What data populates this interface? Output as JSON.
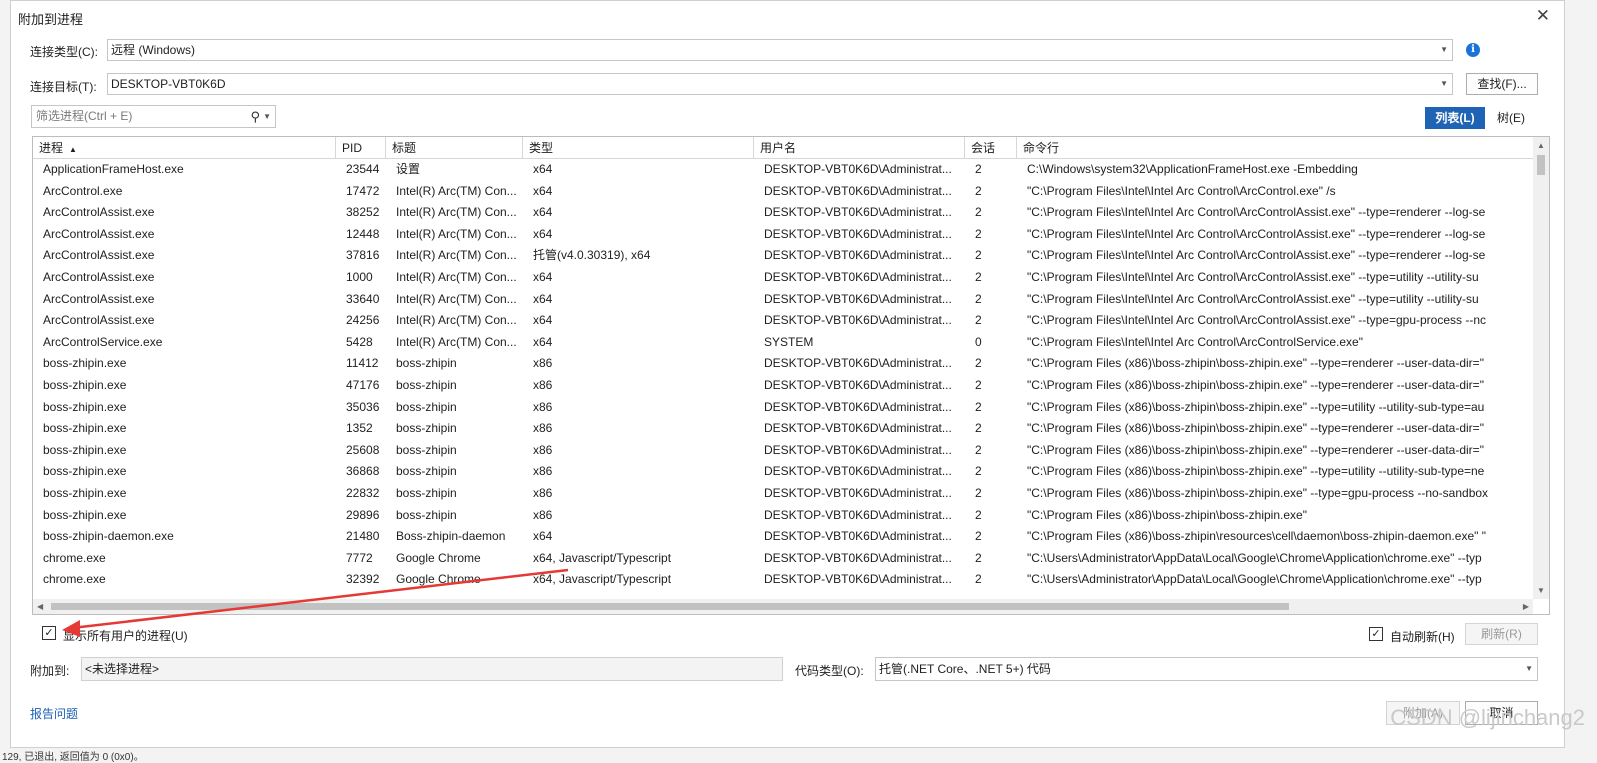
{
  "dialog": {
    "title": "附加到进程",
    "close_glyph": "✕"
  },
  "connection": {
    "type_label": "连接类型(C):",
    "type_value": "远程 (Windows)",
    "target_label": "连接目标(T):",
    "target_value": "DESKTOP-VBT0K6D",
    "find_button": "查找(F)..."
  },
  "filter": {
    "placeholder": "筛选进程(Ctrl + E)"
  },
  "view_toggle": {
    "list": "列表(L)",
    "tree": "树(E)"
  },
  "table": {
    "columns": [
      "进程",
      "PID",
      "标题",
      "类型",
      "用户名",
      "会话",
      "命令行"
    ],
    "rows": [
      [
        "ApplicationFrameHost.exe",
        "23544",
        "设置",
        "x64",
        "DESKTOP-VBT0K6D\\Administrat...",
        "2",
        "C:\\Windows\\system32\\ApplicationFrameHost.exe -Embedding"
      ],
      [
        "ArcControl.exe",
        "17472",
        "Intel(R) Arc(TM) Con...",
        "x64",
        "DESKTOP-VBT0K6D\\Administrat...",
        "2",
        "\"C:\\Program Files\\Intel\\Intel Arc Control\\ArcControl.exe\" /s"
      ],
      [
        "ArcControlAssist.exe",
        "38252",
        "Intel(R) Arc(TM) Con...",
        "x64",
        "DESKTOP-VBT0K6D\\Administrat...",
        "2",
        "\"C:\\Program Files\\Intel\\Intel Arc Control\\ArcControlAssist.exe\" --type=renderer --log-se"
      ],
      [
        "ArcControlAssist.exe",
        "12448",
        "Intel(R) Arc(TM) Con...",
        "x64",
        "DESKTOP-VBT0K6D\\Administrat...",
        "2",
        "\"C:\\Program Files\\Intel\\Intel Arc Control\\ArcControlAssist.exe\" --type=renderer --log-se"
      ],
      [
        "ArcControlAssist.exe",
        "37816",
        "Intel(R) Arc(TM) Con...",
        "托管(v4.0.30319), x64",
        "DESKTOP-VBT0K6D\\Administrat...",
        "2",
        "\"C:\\Program Files\\Intel\\Intel Arc Control\\ArcControlAssist.exe\" --type=renderer --log-se"
      ],
      [
        "ArcControlAssist.exe",
        "1000",
        "Intel(R) Arc(TM) Con...",
        "x64",
        "DESKTOP-VBT0K6D\\Administrat...",
        "2",
        "\"C:\\Program Files\\Intel\\Intel Arc Control\\ArcControlAssist.exe\" --type=utility --utility-su"
      ],
      [
        "ArcControlAssist.exe",
        "33640",
        "Intel(R) Arc(TM) Con...",
        "x64",
        "DESKTOP-VBT0K6D\\Administrat...",
        "2",
        "\"C:\\Program Files\\Intel\\Intel Arc Control\\ArcControlAssist.exe\" --type=utility --utility-su"
      ],
      [
        "ArcControlAssist.exe",
        "24256",
        "Intel(R) Arc(TM) Con...",
        "x64",
        "DESKTOP-VBT0K6D\\Administrat...",
        "2",
        "\"C:\\Program Files\\Intel\\Intel Arc Control\\ArcControlAssist.exe\" --type=gpu-process --nc"
      ],
      [
        "ArcControlService.exe",
        "5428",
        "Intel(R) Arc(TM) Con...",
        "x64",
        "SYSTEM",
        "0",
        "\"C:\\Program Files\\Intel\\Intel Arc Control\\ArcControlService.exe\""
      ],
      [
        "boss-zhipin.exe",
        "11412",
        "boss-zhipin",
        "x86",
        "DESKTOP-VBT0K6D\\Administrat...",
        "2",
        "\"C:\\Program Files (x86)\\boss-zhipin\\boss-zhipin.exe\" --type=renderer --user-data-dir=\""
      ],
      [
        "boss-zhipin.exe",
        "47176",
        "boss-zhipin",
        "x86",
        "DESKTOP-VBT0K6D\\Administrat...",
        "2",
        "\"C:\\Program Files (x86)\\boss-zhipin\\boss-zhipin.exe\" --type=renderer --user-data-dir=\""
      ],
      [
        "boss-zhipin.exe",
        "35036",
        "boss-zhipin",
        "x86",
        "DESKTOP-VBT0K6D\\Administrat...",
        "2",
        "\"C:\\Program Files (x86)\\boss-zhipin\\boss-zhipin.exe\" --type=utility --utility-sub-type=au"
      ],
      [
        "boss-zhipin.exe",
        "1352",
        "boss-zhipin",
        "x86",
        "DESKTOP-VBT0K6D\\Administrat...",
        "2",
        "\"C:\\Program Files (x86)\\boss-zhipin\\boss-zhipin.exe\" --type=renderer --user-data-dir=\""
      ],
      [
        "boss-zhipin.exe",
        "25608",
        "boss-zhipin",
        "x86",
        "DESKTOP-VBT0K6D\\Administrat...",
        "2",
        "\"C:\\Program Files (x86)\\boss-zhipin\\boss-zhipin.exe\" --type=renderer --user-data-dir=\""
      ],
      [
        "boss-zhipin.exe",
        "36868",
        "boss-zhipin",
        "x86",
        "DESKTOP-VBT0K6D\\Administrat...",
        "2",
        "\"C:\\Program Files (x86)\\boss-zhipin\\boss-zhipin.exe\" --type=utility --utility-sub-type=ne"
      ],
      [
        "boss-zhipin.exe",
        "22832",
        "boss-zhipin",
        "x86",
        "DESKTOP-VBT0K6D\\Administrat...",
        "2",
        "\"C:\\Program Files (x86)\\boss-zhipin\\boss-zhipin.exe\" --type=gpu-process --no-sandbox"
      ],
      [
        "boss-zhipin.exe",
        "29896",
        "boss-zhipin",
        "x86",
        "DESKTOP-VBT0K6D\\Administrat...",
        "2",
        "\"C:\\Program Files (x86)\\boss-zhipin\\boss-zhipin.exe\""
      ],
      [
        "boss-zhipin-daemon.exe",
        "21480",
        "Boss-zhipin-daemon",
        "x64",
        "DESKTOP-VBT0K6D\\Administrat...",
        "2",
        "\"C:\\Program Files (x86)\\boss-zhipin\\resources\\cell\\daemon\\boss-zhipin-daemon.exe\" \""
      ],
      [
        "chrome.exe",
        "7772",
        "Google Chrome",
        "x64, Javascript/Typescript",
        "DESKTOP-VBT0K6D\\Administrat...",
        "2",
        "\"C:\\Users\\Administrator\\AppData\\Local\\Google\\Chrome\\Application\\chrome.exe\" --typ"
      ],
      [
        "chrome.exe",
        "32392",
        "Google Chrome",
        "x64, Javascript/Typescript",
        "DESKTOP-VBT0K6D\\Administrat...",
        "2",
        "\"C:\\Users\\Administrator\\AppData\\Local\\Google\\Chrome\\Application\\chrome.exe\" --typ"
      ]
    ]
  },
  "options": {
    "show_all_users": "显示所有用户的进程(U)",
    "show_all_users_checked": true,
    "auto_refresh": "自动刷新(H)",
    "auto_refresh_checked": true,
    "refresh_button": "刷新(R)"
  },
  "attach": {
    "attach_to_label": "附加到:",
    "attach_to_value": "<未选择进程>",
    "code_type_label": "代码类型(O):",
    "code_type_value": "托管(.NET Core、.NET 5+) 代码"
  },
  "footer": {
    "report_link": "报告问题",
    "attach_button": "附加(A)",
    "cancel_button": "取消"
  },
  "watermark": "CSDN @lijinchang2",
  "backdrop": {
    "status_text": "129, 已退出, 返回值为 0 (0x0)。"
  },
  "colors": {
    "accent": "#1e63b4",
    "link": "#1a5fb4",
    "annotation_arrow": "#e53935"
  }
}
